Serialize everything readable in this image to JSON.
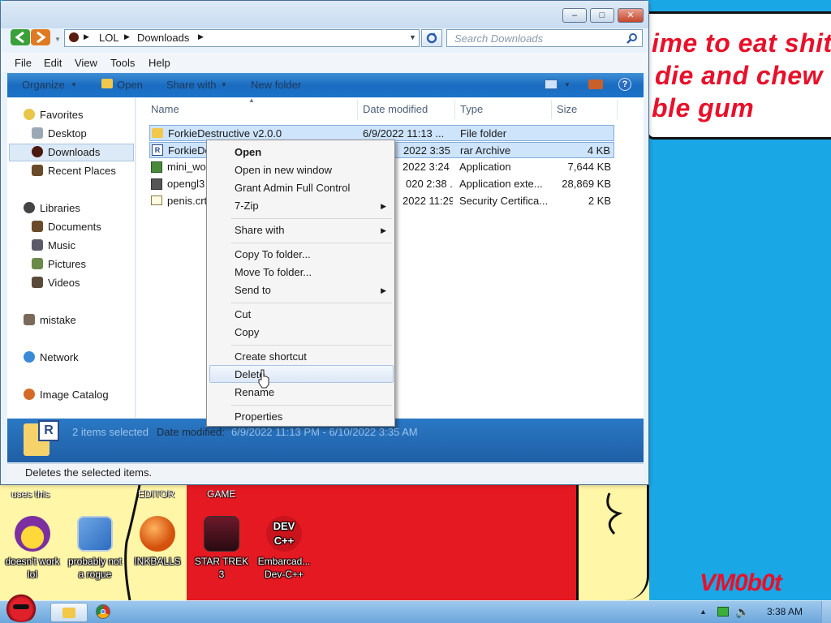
{
  "wallpaper": {
    "note_lines": [
      "ime to eat shit",
      "die and chew",
      "ble gum"
    ],
    "signature": "VM0b0t",
    "top_labels": [
      "uses this",
      "EDITOR",
      "GAME"
    ]
  },
  "desktop_icons": [
    {
      "label": "doesn't work lol",
      "icon": "yahoo-messenger-icon"
    },
    {
      "label": "probably not a rogue",
      "icon": "settings-gears-icon"
    },
    {
      "label": "INKBALLS",
      "icon": "inkball-icon"
    },
    {
      "label": "STAR TREK 3",
      "icon": "star-wars-icon"
    },
    {
      "label": "Embarcad... Dev-C++",
      "icon": "devcpp-icon"
    }
  ],
  "window": {
    "caption_buttons": {
      "min": "–",
      "max": "□",
      "close": "✕"
    },
    "breadcrumb": [
      "LOL",
      "Downloads"
    ],
    "search_placeholder": "Search Downloads",
    "menus": [
      "File",
      "Edit",
      "View",
      "Tools",
      "Help"
    ],
    "toolbar": {
      "organize": "Organize",
      "open": "Open",
      "share": "Share with",
      "new_folder": "New folder"
    },
    "nav": {
      "favorites": "Favorites",
      "desktop": "Desktop",
      "downloads": "Downloads",
      "recent": "Recent Places",
      "libraries": "Libraries",
      "documents": "Documents",
      "music": "Music",
      "pictures": "Pictures",
      "videos": "Videos",
      "mistake": "mistake",
      "network": "Network",
      "image_catalog": "Image Catalog"
    },
    "columns": {
      "name": "Name",
      "date": "Date modified",
      "type": "Type",
      "size": "Size"
    },
    "files": [
      {
        "name": "ForkieDestructive v2.0.0",
        "date": "6/9/2022 11:13 ...",
        "type": "File folder",
        "size": "",
        "selected": true
      },
      {
        "name": "ForkieDe",
        "date": "2022 3:35 ...",
        "type": "rar Archive",
        "size": "4 KB",
        "selected": true
      },
      {
        "name": "mini_wor",
        "date": "2022 3:24 ...",
        "type": "Application",
        "size": "7,644 KB",
        "selected": false
      },
      {
        "name": "opengl3",
        "date": "020 2:38 ...",
        "type": "Application exte...",
        "size": "28,869 KB",
        "selected": false
      },
      {
        "name": "penis.crt",
        "date": "2022 11:29 ...",
        "type": "Security Certifica...",
        "size": "2 KB",
        "selected": false
      }
    ],
    "details": {
      "selected": "2 items selected",
      "date_label": "Date modified:",
      "date_value": "6/9/2022 11:13 PM - 6/10/2022 3:35 AM"
    },
    "status": "Deletes the selected items."
  },
  "context_menu": {
    "open": "Open",
    "open_new": "Open in new window",
    "grant": "Grant Admin Full Control",
    "zip": "7-Zip",
    "share": "Share with",
    "copy_to": "Copy To folder...",
    "move_to": "Move To folder...",
    "send_to": "Send to",
    "cut": "Cut",
    "copy": "Copy",
    "shortcut": "Create shortcut",
    "delete": "Delete",
    "rename": "Rename",
    "properties": "Properties"
  },
  "taskbar": {
    "clock": "3:38 AM"
  },
  "colors": {
    "desktop": "#1aa7e6",
    "wall_red": "#e51922",
    "wall_yellow": "#fff6a8",
    "selection": "#cde4fb"
  }
}
